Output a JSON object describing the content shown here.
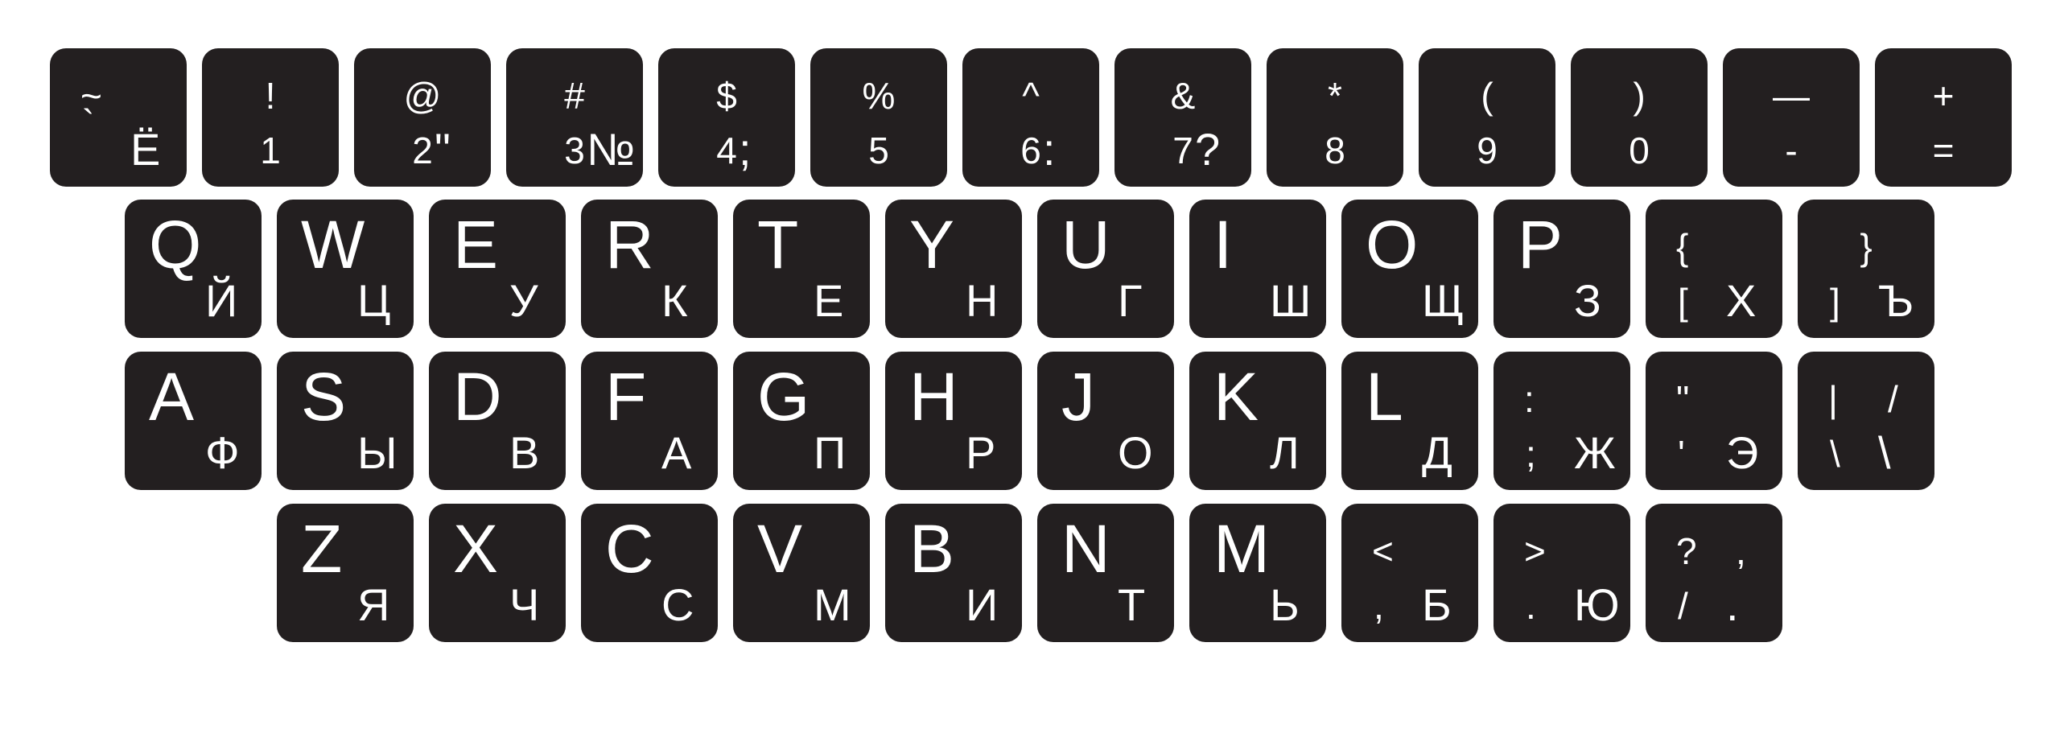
{
  "keyboard": {
    "layout": "QWERTY / ЙЦУКЕН",
    "key_color": "#231f20",
    "label_color": "#ffffff",
    "rows": [
      [
        {
          "id": "backquote",
          "labels": [
            {
              "t": "~",
              "pos": "tl"
            },
            {
              "t": "`",
              "pos": "ml"
            },
            {
              "t": "Ё",
              "pos": "br"
            }
          ]
        },
        {
          "id": "1",
          "labels": [
            {
              "t": "!",
              "pos": "tc"
            },
            {
              "t": "1",
              "pos": "bc"
            }
          ]
        },
        {
          "id": "2",
          "labels": [
            {
              "t": "@",
              "pos": "tc"
            },
            {
              "t": "2",
              "pos": "bc"
            },
            {
              "t": "\"",
              "pos": "br"
            }
          ]
        },
        {
          "id": "3",
          "labels": [
            {
              "t": "#",
              "pos": "tc"
            },
            {
              "t": "3",
              "pos": "bc"
            },
            {
              "t": "№",
              "pos": "br"
            }
          ]
        },
        {
          "id": "4",
          "labels": [
            {
              "t": "$",
              "pos": "tc"
            },
            {
              "t": "4",
              "pos": "bc"
            },
            {
              "t": ";",
              "pos": "br"
            }
          ]
        },
        {
          "id": "5",
          "labels": [
            {
              "t": "%",
              "pos": "tc"
            },
            {
              "t": "5",
              "pos": "bc"
            }
          ]
        },
        {
          "id": "6",
          "labels": [
            {
              "t": "^",
              "pos": "tc"
            },
            {
              "t": "6",
              "pos": "bc"
            },
            {
              "t": ":",
              "pos": "br"
            }
          ]
        },
        {
          "id": "7",
          "labels": [
            {
              "t": "&",
              "pos": "tc"
            },
            {
              "t": "7",
              "pos": "bc"
            },
            {
              "t": "?",
              "pos": "br"
            }
          ]
        },
        {
          "id": "8",
          "labels": [
            {
              "t": "*",
              "pos": "tc"
            },
            {
              "t": "8",
              "pos": "bc"
            }
          ]
        },
        {
          "id": "9",
          "labels": [
            {
              "t": "(",
              "pos": "tc"
            },
            {
              "t": "9",
              "pos": "bc"
            }
          ]
        },
        {
          "id": "0",
          "labels": [
            {
              "t": ")",
              "pos": "tc"
            },
            {
              "t": "0",
              "pos": "bc"
            }
          ]
        },
        {
          "id": "minus",
          "labels": [
            {
              "t": "—",
              "pos": "tc"
            },
            {
              "t": "-",
              "pos": "bc"
            }
          ]
        },
        {
          "id": "equals",
          "labels": [
            {
              "t": "+",
              "pos": "tc"
            },
            {
              "t": "=",
              "pos": "bc"
            }
          ]
        }
      ],
      [
        {
          "id": "q",
          "labels": [
            {
              "t": "Q",
              "pos": "big"
            },
            {
              "t": "Й",
              "pos": "br"
            }
          ]
        },
        {
          "id": "w",
          "labels": [
            {
              "t": "W",
              "pos": "big"
            },
            {
              "t": "Ц",
              "pos": "br"
            }
          ]
        },
        {
          "id": "e",
          "labels": [
            {
              "t": "E",
              "pos": "big"
            },
            {
              "t": "У",
              "pos": "br"
            }
          ]
        },
        {
          "id": "r",
          "labels": [
            {
              "t": "R",
              "pos": "big"
            },
            {
              "t": "К",
              "pos": "br"
            }
          ]
        },
        {
          "id": "t",
          "labels": [
            {
              "t": "T",
              "pos": "big"
            },
            {
              "t": "Е",
              "pos": "br"
            }
          ]
        },
        {
          "id": "y",
          "labels": [
            {
              "t": "Y",
              "pos": "big"
            },
            {
              "t": "Н",
              "pos": "br"
            }
          ]
        },
        {
          "id": "u",
          "labels": [
            {
              "t": "U",
              "pos": "big"
            },
            {
              "t": "Г",
              "pos": "br"
            }
          ]
        },
        {
          "id": "i",
          "labels": [
            {
              "t": "I",
              "pos": "big"
            },
            {
              "t": "Ш",
              "pos": "br"
            }
          ]
        },
        {
          "id": "o",
          "labels": [
            {
              "t": "O",
              "pos": "big"
            },
            {
              "t": "Щ",
              "pos": "br"
            }
          ]
        },
        {
          "id": "p",
          "labels": [
            {
              "t": "P",
              "pos": "big"
            },
            {
              "t": "З",
              "pos": "br"
            }
          ]
        },
        {
          "id": "bracket-left",
          "labels": [
            {
              "t": "{",
              "pos": "tl"
            },
            {
              "t": "[",
              "pos": "bl"
            },
            {
              "t": "Х",
              "pos": "br"
            }
          ]
        },
        {
          "id": "bracket-right",
          "labels": [
            {
              "t": "}",
              "pos": "tc"
            },
            {
              "t": "]",
              "pos": "bl"
            },
            {
              "t": "Ъ",
              "pos": "br"
            }
          ]
        }
      ],
      [
        {
          "id": "a",
          "labels": [
            {
              "t": "A",
              "pos": "big"
            },
            {
              "t": "Ф",
              "pos": "br"
            }
          ]
        },
        {
          "id": "s",
          "labels": [
            {
              "t": "S",
              "pos": "big"
            },
            {
              "t": "Ы",
              "pos": "br"
            }
          ]
        },
        {
          "id": "d",
          "labels": [
            {
              "t": "D",
              "pos": "big"
            },
            {
              "t": "В",
              "pos": "br"
            }
          ]
        },
        {
          "id": "f",
          "labels": [
            {
              "t": "F",
              "pos": "big"
            },
            {
              "t": "А",
              "pos": "br"
            }
          ]
        },
        {
          "id": "g",
          "labels": [
            {
              "t": "G",
              "pos": "big"
            },
            {
              "t": "П",
              "pos": "br"
            }
          ]
        },
        {
          "id": "h",
          "labels": [
            {
              "t": "H",
              "pos": "big"
            },
            {
              "t": "Р",
              "pos": "br"
            }
          ]
        },
        {
          "id": "j",
          "labels": [
            {
              "t": "J",
              "pos": "big"
            },
            {
              "t": "О",
              "pos": "br"
            }
          ]
        },
        {
          "id": "k",
          "labels": [
            {
              "t": "K",
              "pos": "big"
            },
            {
              "t": "Л",
              "pos": "br"
            }
          ]
        },
        {
          "id": "l",
          "labels": [
            {
              "t": "L",
              "pos": "big"
            },
            {
              "t": "Д",
              "pos": "br"
            }
          ]
        },
        {
          "id": "semicolon",
          "labels": [
            {
              "t": ":",
              "pos": "tl"
            },
            {
              "t": ";",
              "pos": "bl"
            },
            {
              "t": "Ж",
              "pos": "br"
            }
          ]
        },
        {
          "id": "quote",
          "labels": [
            {
              "t": "\"",
              "pos": "tl"
            },
            {
              "t": "'",
              "pos": "bl"
            },
            {
              "t": "Э",
              "pos": "br"
            }
          ]
        },
        {
          "id": "backslash",
          "labels": [
            {
              "t": "|",
              "pos": "tl"
            },
            {
              "t": "/",
              "pos": "tr"
            },
            {
              "t": "\\",
              "pos": "bl"
            },
            {
              "t": "\\",
              "pos": "br"
            }
          ]
        }
      ],
      [
        {
          "id": "z",
          "labels": [
            {
              "t": "Z",
              "pos": "big"
            },
            {
              "t": "Я",
              "pos": "br"
            }
          ]
        },
        {
          "id": "x",
          "labels": [
            {
              "t": "X",
              "pos": "big"
            },
            {
              "t": "Ч",
              "pos": "br"
            }
          ]
        },
        {
          "id": "c",
          "labels": [
            {
              "t": "C",
              "pos": "big"
            },
            {
              "t": "С",
              "pos": "br"
            }
          ]
        },
        {
          "id": "v",
          "labels": [
            {
              "t": "V",
              "pos": "big"
            },
            {
              "t": "М",
              "pos": "br"
            }
          ]
        },
        {
          "id": "b",
          "labels": [
            {
              "t": "B",
              "pos": "big"
            },
            {
              "t": "И",
              "pos": "br"
            }
          ]
        },
        {
          "id": "n",
          "labels": [
            {
              "t": "N",
              "pos": "big"
            },
            {
              "t": "Т",
              "pos": "br"
            }
          ]
        },
        {
          "id": "m",
          "labels": [
            {
              "t": "M",
              "pos": "big"
            },
            {
              "t": "Ь",
              "pos": "br"
            }
          ]
        },
        {
          "id": "comma",
          "labels": [
            {
              "t": "<",
              "pos": "tl"
            },
            {
              "t": ",",
              "pos": "bl"
            },
            {
              "t": "Б",
              "pos": "br"
            }
          ]
        },
        {
          "id": "period",
          "labels": [
            {
              "t": ">",
              "pos": "tl"
            },
            {
              "t": ".",
              "pos": "bl"
            },
            {
              "t": "Ю",
              "pos": "br"
            }
          ]
        },
        {
          "id": "slash",
          "labels": [
            {
              "t": "?",
              "pos": "tl"
            },
            {
              "t": ",",
              "pos": "tr"
            },
            {
              "t": "/",
              "pos": "bl"
            },
            {
              "t": ".",
              "pos": "br"
            }
          ]
        }
      ]
    ]
  }
}
